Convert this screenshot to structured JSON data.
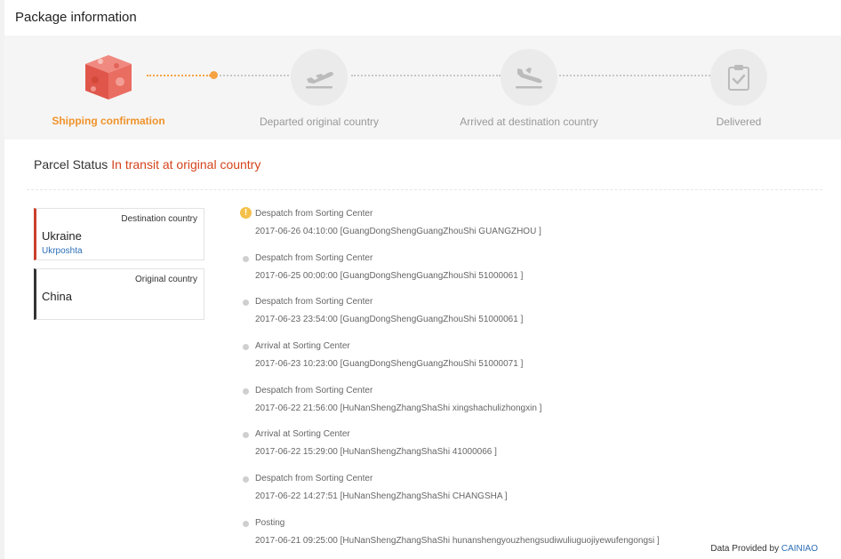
{
  "page": {
    "title": "Package information"
  },
  "progress": {
    "steps": [
      {
        "label": "Shipping confirmation",
        "icon": "package-box-icon",
        "active": true
      },
      {
        "label": "Departed original country",
        "icon": "plane-departure-icon",
        "active": false
      },
      {
        "label": "Arrived at destination country",
        "icon": "plane-arrival-icon",
        "active": false
      },
      {
        "label": "Delivered",
        "icon": "clipboard-check-icon",
        "active": false
      }
    ]
  },
  "parcel": {
    "status_label": "Parcel Status",
    "status_value": "In transit at original country"
  },
  "destination": {
    "label": "Destination country",
    "country": "Ukraine",
    "carrier": "Ukrposhta"
  },
  "origin": {
    "label": "Original country",
    "country": "China"
  },
  "events": [
    {
      "title": "Despatch from Sorting Center",
      "detail": "2017-06-26 04:10:00 [GuangDongShengGuangZhouShi GUANGZHOU ]"
    },
    {
      "title": "Despatch from Sorting Center",
      "detail": "2017-06-25 00:00:00 [GuangDongShengGuangZhouShi 51000061 ]"
    },
    {
      "title": "Despatch from Sorting Center",
      "detail": "2017-06-23 23:54:00 [GuangDongShengGuangZhouShi 51000061 ]"
    },
    {
      "title": "Arrival at Sorting Center",
      "detail": "2017-06-23 10:23:00 [GuangDongShengGuangZhouShi 51000071 ]"
    },
    {
      "title": "Despatch from Sorting Center",
      "detail": "2017-06-22 21:56:00 [HuNanShengZhangShaShi xingshachulizhongxin ]"
    },
    {
      "title": "Arrival at Sorting Center",
      "detail": "2017-06-22 15:29:00 [HuNanShengZhangShaShi 41000066 ]"
    },
    {
      "title": "Despatch from Sorting Center",
      "detail": "2017-06-22 14:27:51 [HuNanShengZhangShaShi CHANGSHA ]"
    },
    {
      "title": "Posting",
      "detail": "2017-06-21 09:25:00 [HuNanShengZhangShaShi hunanshengyouzhengsudiwuliuguojiyewufengongsi ]"
    }
  ],
  "footer": {
    "prefix": "Data Provided by",
    "provider": "CAINIAO"
  },
  "colors": {
    "accent": "#f0932b",
    "status": "#d4441c",
    "link": "#2c6fb7"
  }
}
